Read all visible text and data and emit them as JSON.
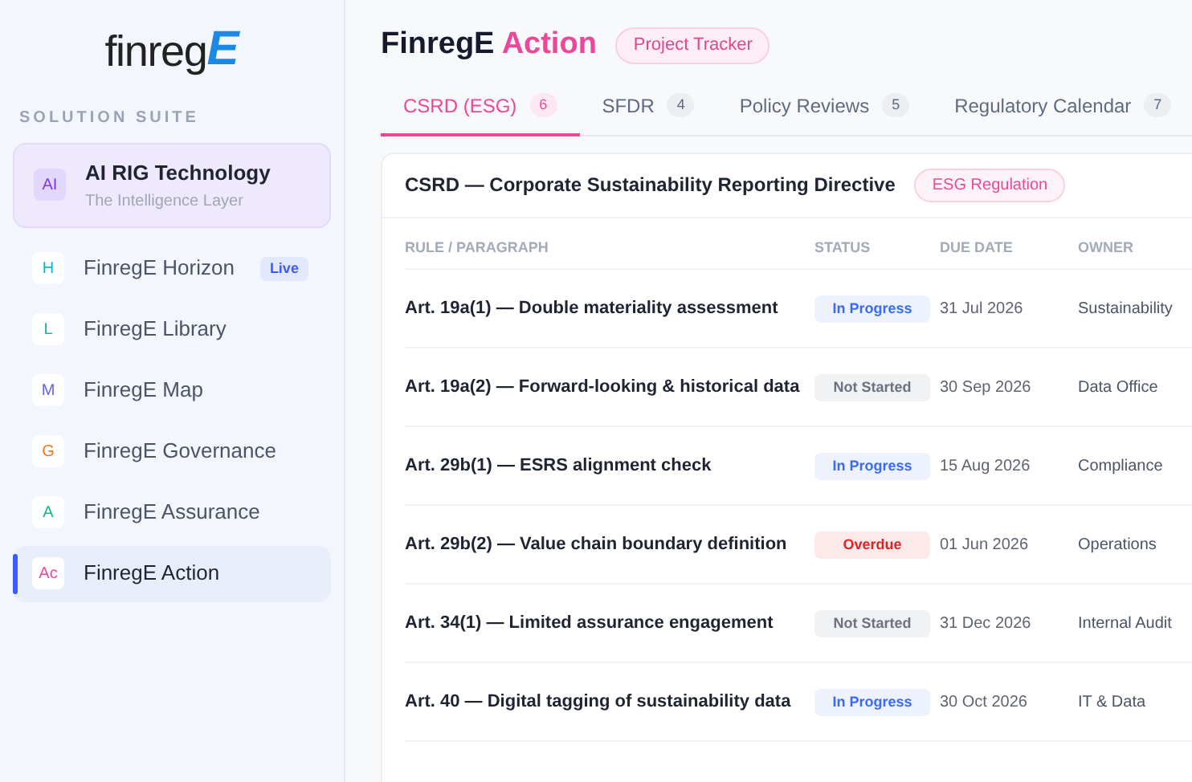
{
  "logo": {
    "text": "finreg",
    "mark": "E"
  },
  "sidebar": {
    "section_label": "SOLUTION SUITE",
    "featured": {
      "icon_text": "AI",
      "title": "AI RIG Technology",
      "subtitle": "The Intelligence Layer"
    },
    "items": [
      {
        "icon_text": "H",
        "label": "FinregE Horizon",
        "badge": "Live",
        "color": "#06b6d4",
        "selected": false
      },
      {
        "icon_text": "L",
        "label": "FinregE Library",
        "color": "#14b8a6",
        "selected": false
      },
      {
        "icon_text": "M",
        "label": "FinregE Map",
        "color": "#6366f1",
        "selected": false
      },
      {
        "icon_text": "G",
        "label": "FinregE Governance",
        "color": "#f97316",
        "selected": false
      },
      {
        "icon_text": "A",
        "label": "FinregE Assurance",
        "color": "#10b981",
        "selected": false
      },
      {
        "icon_text": "Ac",
        "label": "FinregE Action",
        "color": "#ec4899",
        "selected": true
      }
    ]
  },
  "header": {
    "title": "FinregE",
    "title_accent": "Action",
    "badge": "Project Tracker"
  },
  "tabs": [
    {
      "label": "CSRD (ESG)",
      "count": "6",
      "selected": true
    },
    {
      "label": "SFDR",
      "count": "4",
      "selected": false
    },
    {
      "label": "Policy Reviews",
      "count": "5",
      "selected": false
    },
    {
      "label": "Regulatory Calendar",
      "count": "7",
      "selected": false
    }
  ],
  "card": {
    "title": "CSRD — Corporate Sustainability Reporting Directive",
    "tag": "ESG Regulation",
    "table": {
      "columns": [
        "RULE / PARAGRAPH",
        "STATUS",
        "DUE DATE",
        "OWNER"
      ],
      "rows": [
        {
          "rule": "Art. 19a(1) — Double materiality assessment",
          "status": "In Progress",
          "kind": "in_progress",
          "due": "31 Jul 2026",
          "owner": "Sustainability"
        },
        {
          "rule": "Art. 19a(2) — Forward-looking & historical data",
          "status": "Not Started",
          "kind": "not_started",
          "due": "30 Sep 2026",
          "owner": "Data Office"
        },
        {
          "rule": "Art. 29b(1) — ESRS alignment check",
          "status": "In Progress",
          "kind": "in_progress",
          "due": "15 Aug 2026",
          "owner": "Compliance"
        },
        {
          "rule": "Art. 29b(2) — Value chain boundary definition",
          "status": "Overdue",
          "kind": "overdue",
          "due": "01 Jun 2026",
          "owner": "Operations"
        },
        {
          "rule": "Art. 34(1) — Limited assurance engagement",
          "status": "Not Started",
          "kind": "not_started",
          "due": "31 Dec 2026",
          "owner": "Internal Audit"
        },
        {
          "rule": "Art. 40 — Digital tagging of sustainability data",
          "status": "In Progress",
          "kind": "in_progress",
          "due": "30 Oct 2026",
          "owner": "IT & Data"
        }
      ]
    }
  }
}
